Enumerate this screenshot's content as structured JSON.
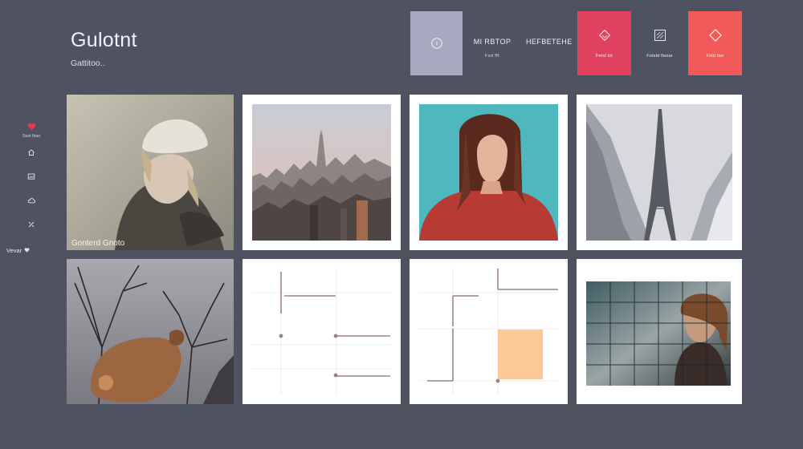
{
  "header": {
    "title": "Gulotnt",
    "subtitle": "Gattitoo.."
  },
  "topbar": {
    "tiles": [
      {
        "icon": "circle-icon",
        "caption": ""
      },
      {
        "icon": "diamond-icon",
        "caption": "Fetsl lot"
      },
      {
        "icon": "grid-icon",
        "caption": "Fotsld fisoar"
      },
      {
        "icon": "diamond-icon",
        "caption": "Fold Itar"
      }
    ],
    "nav": [
      {
        "label": "MI RBTOP",
        "caption": "Fsd fft"
      },
      {
        "label": "HEFBETEHE",
        "caption": ""
      }
    ]
  },
  "sidebar": {
    "items": [
      {
        "icon": "heart-icon",
        "label": "Ssst fsso",
        "color": "#e43a4b"
      },
      {
        "icon": "home-icon",
        "label": ""
      },
      {
        "icon": "image-icon",
        "label": ""
      },
      {
        "icon": "cloud-icon",
        "label": ""
      },
      {
        "icon": "tools-icon",
        "label": ""
      }
    ],
    "footer": "Vevar"
  },
  "grid": {
    "cards": [
      {
        "subject": "portrait-beanie",
        "caption": "Gonterd Gnoto"
      },
      {
        "subject": "city-skyline",
        "caption": ""
      },
      {
        "subject": "portrait-teal",
        "caption": ""
      },
      {
        "subject": "tower-snow",
        "caption": ""
      },
      {
        "subject": "animal-trees",
        "caption": ""
      },
      {
        "subject": "wireframe-lines",
        "caption": ""
      },
      {
        "subject": "wireframe-peach",
        "caption": ""
      },
      {
        "subject": "portrait-grid",
        "caption": ""
      }
    ]
  },
  "colors": {
    "background": "#4f5261",
    "tile_grey": "#a7a9c1",
    "tile_pink": "#e0415e",
    "tile_red": "#f25a5a",
    "peach": "#fcc898",
    "wire_line": "#9b7f96"
  }
}
